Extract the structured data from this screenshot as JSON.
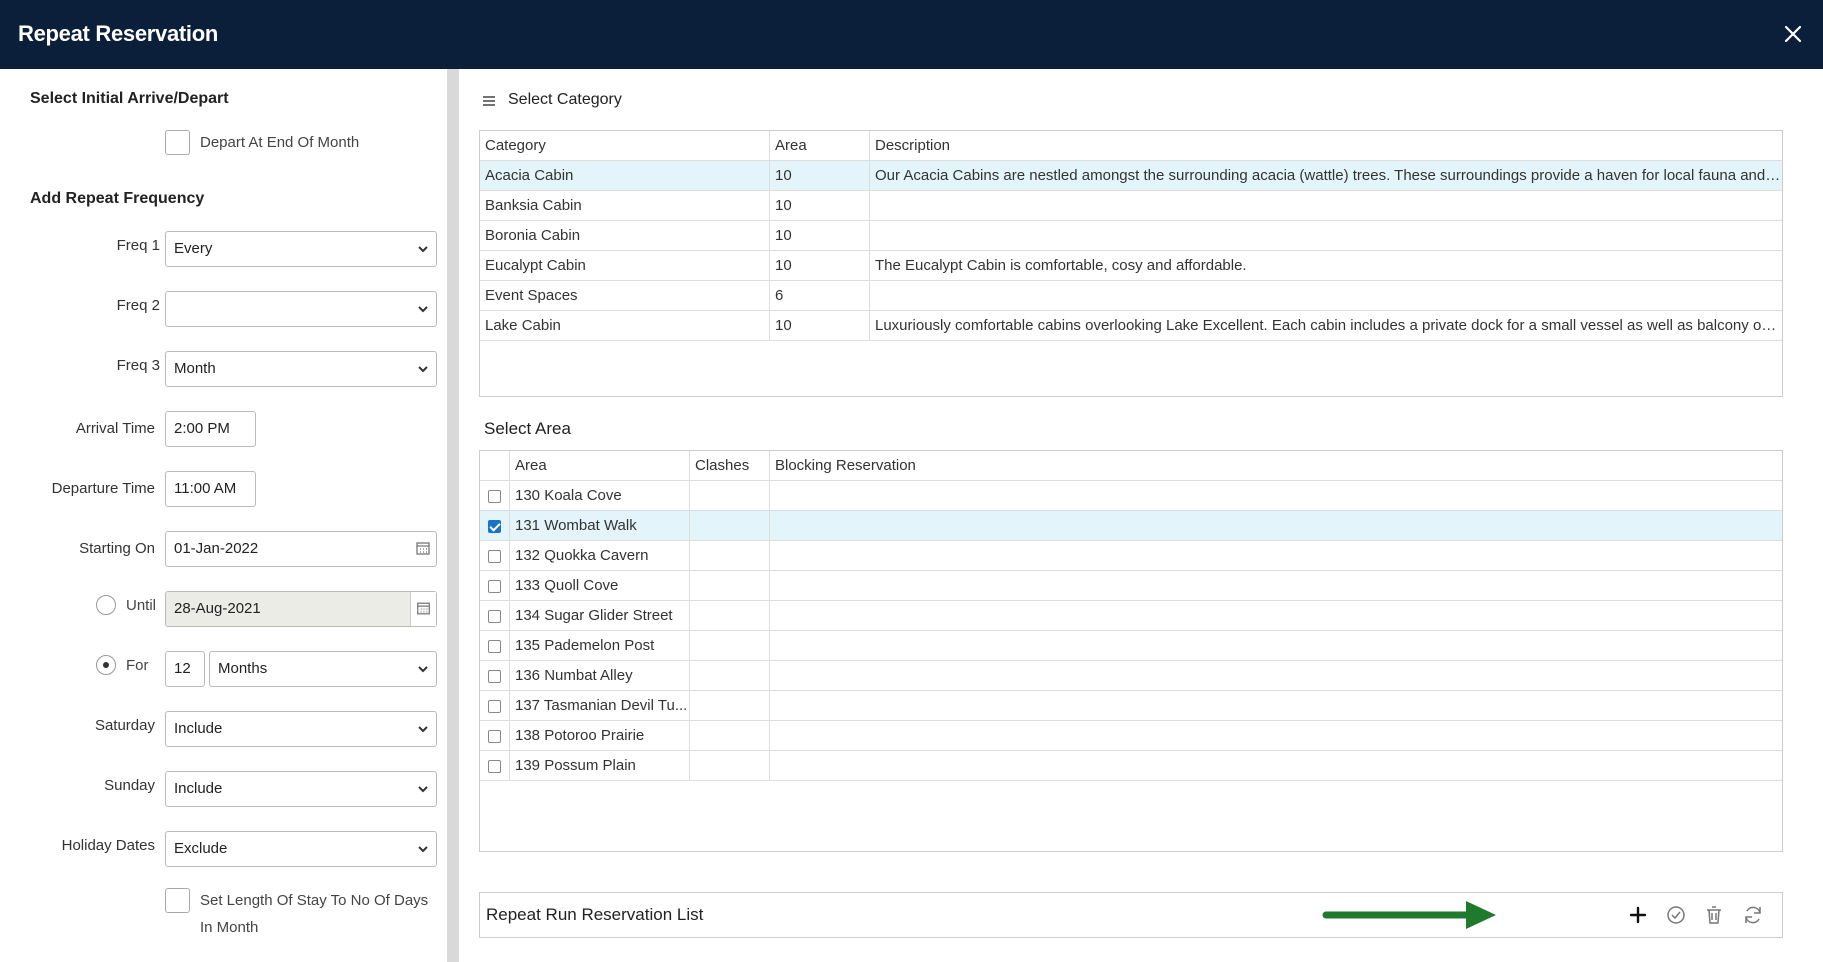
{
  "window": {
    "title": "Repeat Reservation",
    "close_icon": "close-icon"
  },
  "left": {
    "initial_title": "Select Initial Arrive/Depart",
    "depart_end_month_label": "Depart At End Of Month",
    "repeat_title": "Add Repeat Frequency",
    "freq1": {
      "label": "Freq 1",
      "value": "Every"
    },
    "freq2": {
      "label": "Freq 2",
      "value": ""
    },
    "freq3": {
      "label": "Freq 3",
      "value": "Month"
    },
    "arrival_time": {
      "label": "Arrival Time",
      "value": "2:00 PM"
    },
    "departure_time": {
      "label": "Departure Time",
      "value": "11:00 AM"
    },
    "starting_on": {
      "label": "Starting On",
      "value": "01-Jan-2022"
    },
    "until": {
      "label": "Until",
      "value": "28-Aug-2021"
    },
    "for": {
      "label": "For",
      "count": "12",
      "unit": "Months"
    },
    "saturday": {
      "label": "Saturday",
      "value": "Include"
    },
    "sunday": {
      "label": "Sunday",
      "value": "Include"
    },
    "holiday_dates": {
      "label": "Holiday Dates",
      "value": "Exclude"
    },
    "set_length_label_1": "Set Length Of Stay To No Of Days",
    "set_length_label_2": "In Month"
  },
  "category": {
    "title": "Select Category",
    "menu_icon": "menu-icon",
    "headers": {
      "category": "Category",
      "area": "Area",
      "description": "Description"
    },
    "rows": [
      {
        "category": "Acacia Cabin",
        "area": "10",
        "description": "Our Acacia Cabins are nestled amongst the surrounding acacia (wattle) trees. These surroundings provide a haven for local fauna and bir..."
      },
      {
        "category": "Banksia Cabin",
        "area": "10",
        "description": ""
      },
      {
        "category": "Boronia Cabin",
        "area": "10",
        "description": ""
      },
      {
        "category": "Eucalypt Cabin",
        "area": "10",
        "description": "The Eucalypt Cabin is comfortable, cosy and affordable."
      },
      {
        "category": "Event Spaces",
        "area": "6",
        "description": ""
      },
      {
        "category": "Lake Cabin",
        "area": "10",
        "description": "Luxuriously comfortable cabins overlooking Lake Excellent. Each cabin includes a private dock for a small vessel as well as balcony on all ..."
      }
    ]
  },
  "area": {
    "title": "Select Area",
    "headers": {
      "area": "Area",
      "clashes": "Clashes",
      "blocking": "Blocking Reservation"
    },
    "rows": [
      {
        "area": "130 Koala Cove"
      },
      {
        "area": "131 Wombat Walk"
      },
      {
        "area": "132 Quokka Cavern"
      },
      {
        "area": "133 Quoll Cove"
      },
      {
        "area": "134 Sugar Glider Street"
      },
      {
        "area": "135 Pademelon Post"
      },
      {
        "area": "136 Numbat Alley"
      },
      {
        "area": "137 Tasmanian Devil Tu..."
      },
      {
        "area": "138 Potoroo Prairie"
      },
      {
        "area": "139 Possum Plain"
      }
    ]
  },
  "repeat_list": {
    "title": "Repeat Run Reservation List",
    "tools": [
      "plus-icon",
      "check-circle-icon",
      "trash-icon",
      "refresh-icon"
    ]
  },
  "colors": {
    "titlebar": "#0b1f3a",
    "selected_row": "#e3f5fa",
    "arrow": "#1f7a2e"
  }
}
